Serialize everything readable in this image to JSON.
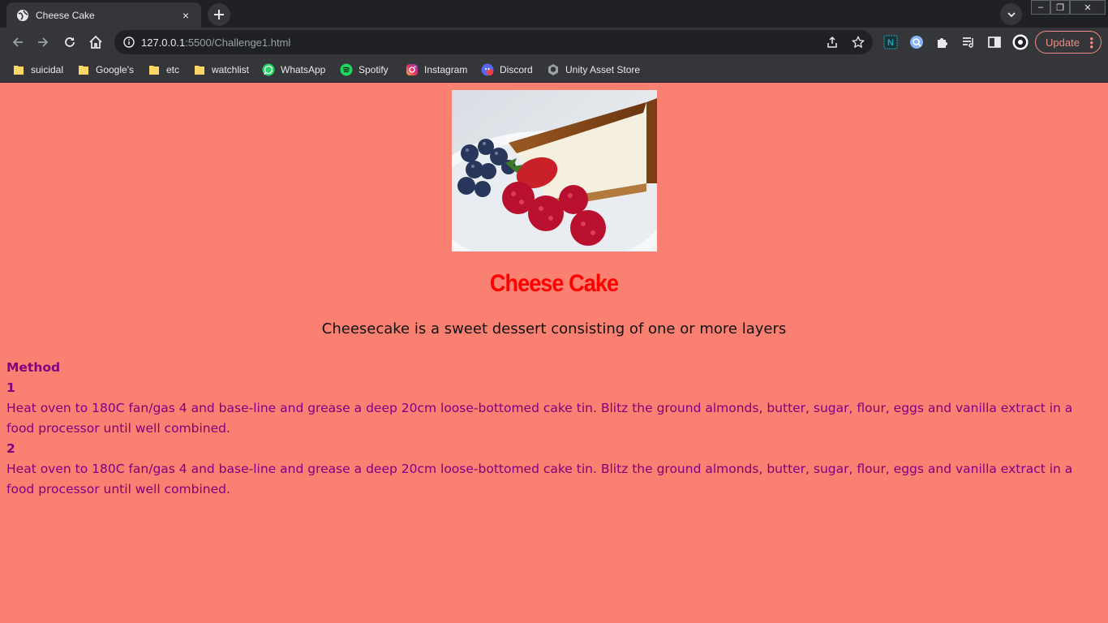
{
  "browser": {
    "tab": {
      "title": "Cheese Cake",
      "close": "×"
    },
    "new_tab": "+",
    "window_controls": {
      "minimize": "–",
      "maximize": "❐",
      "close": "✕"
    },
    "address": {
      "host": "127.0.0.1",
      "path": ":5500/Challenge1.html"
    },
    "update_label": "Update",
    "bookmarks": [
      {
        "label": "suicidal",
        "icon": "folder-icon"
      },
      {
        "label": "Google's",
        "icon": "folder-icon"
      },
      {
        "label": "etc",
        "icon": "folder-icon"
      },
      {
        "label": "watchlist",
        "icon": "folder-icon"
      },
      {
        "label": "WhatsApp",
        "icon": "whatsapp-icon"
      },
      {
        "label": "Spotify",
        "icon": "spotify-icon"
      },
      {
        "label": "Instagram",
        "icon": "instagram-icon"
      },
      {
        "label": "Discord",
        "icon": "discord-icon"
      },
      {
        "label": "Unity Asset Store",
        "icon": "unity-icon"
      }
    ],
    "colors": {
      "frame": "#202124",
      "toolbar": "#35363a",
      "update_accent": "#f28b82"
    }
  },
  "page": {
    "background": "#fa8072",
    "image_subject": "cheesecake slice with blueberries, strawberry and raspberries",
    "heading": "Cheese Cake",
    "tagline": "Cheesecake is a sweet dessert consisting of one or more layers",
    "method": {
      "title": "Method",
      "steps": [
        {
          "number": "1",
          "text": "Heat oven to 180C fan/gas 4 and base-line and grease a deep 20cm loose-bottomed cake tin. Blitz the ground almonds, butter, sugar, flour, eggs and vanilla extract in a food processor until well combined."
        },
        {
          "number": "2",
          "text": "Heat oven to 180C fan/gas 4 and base-line and grease a deep 20cm loose-bottomed cake tin. Blitz the ground almonds, butter, sugar, flour, eggs and vanilla extract in a food processor until well combined."
        }
      ]
    },
    "colors": {
      "heading": "#ff0000",
      "method_text": "#800080"
    }
  }
}
